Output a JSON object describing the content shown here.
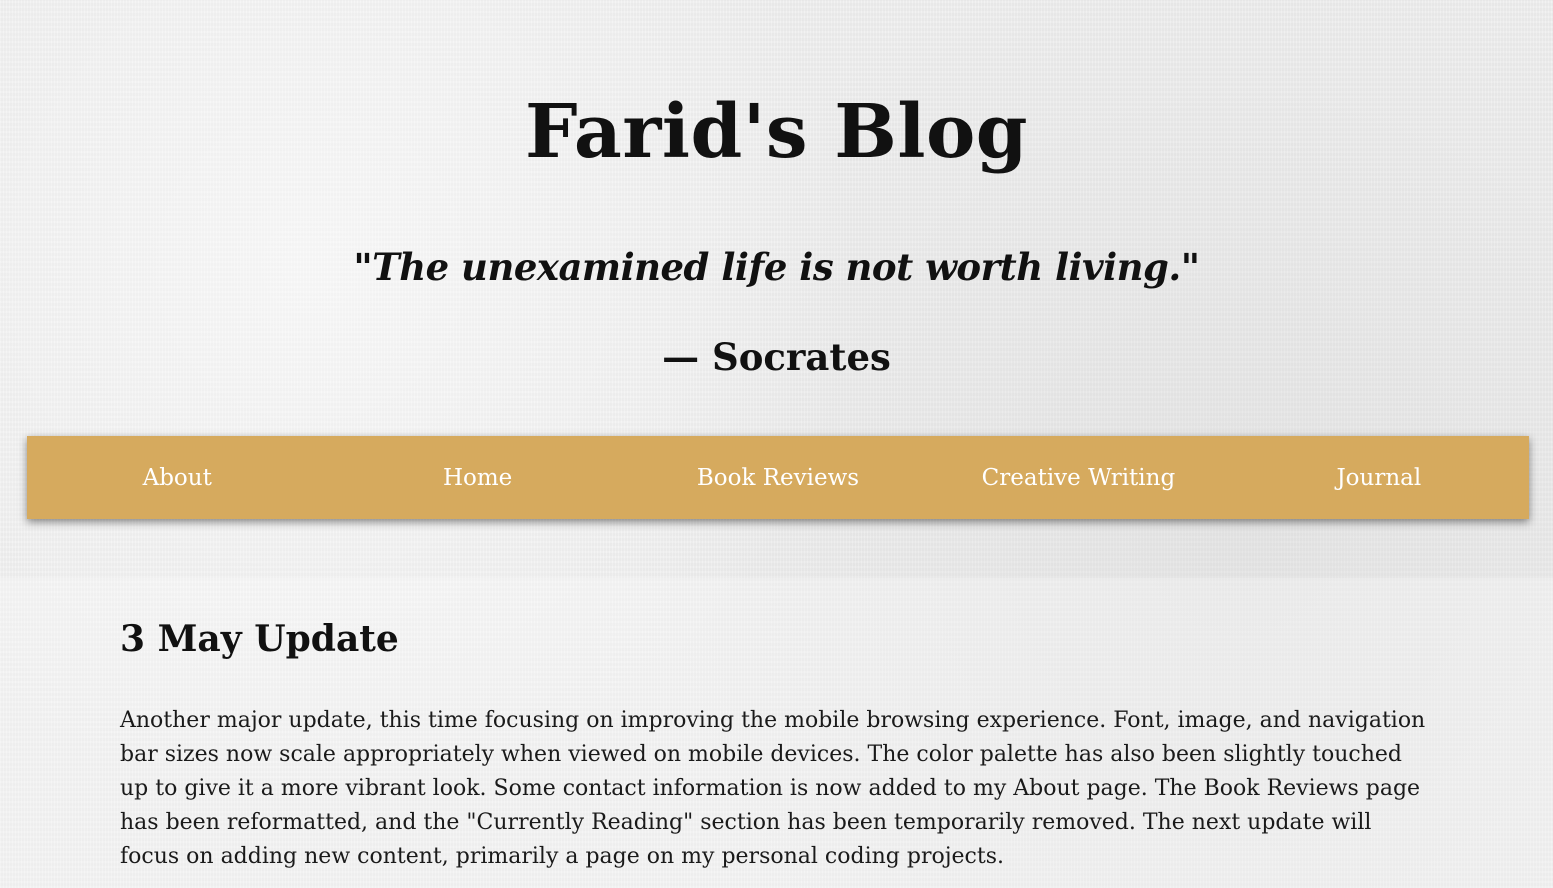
{
  "header": {
    "site_title": "Farid's Blog",
    "quote": "\"The unexamined life is not worth living.\"",
    "quote_author": "— Socrates"
  },
  "nav": {
    "items": [
      {
        "label": "About"
      },
      {
        "label": "Home"
      },
      {
        "label": "Book Reviews"
      },
      {
        "label": "Creative Writing"
      },
      {
        "label": "Journal"
      }
    ]
  },
  "post": {
    "title": "3 May Update",
    "body": "Another major update, this time focusing on improving the mobile browsing experience. Font, image, and navigation bar sizes now scale appropriately when viewed on mobile devices. The color palette has also been slightly touched up to give it a more vibrant look. Some contact information is now added to my About page. The Book Reviews page has been reformatted, and the \"Currently Reading\" section has been temporarily removed. The next update will focus on adding new content, primarily a page on my personal coding projects."
  },
  "colors": {
    "background": "#eeeeee",
    "nav_background": "#d6aa5e",
    "nav_text": "#ffffff",
    "text": "#111111"
  }
}
